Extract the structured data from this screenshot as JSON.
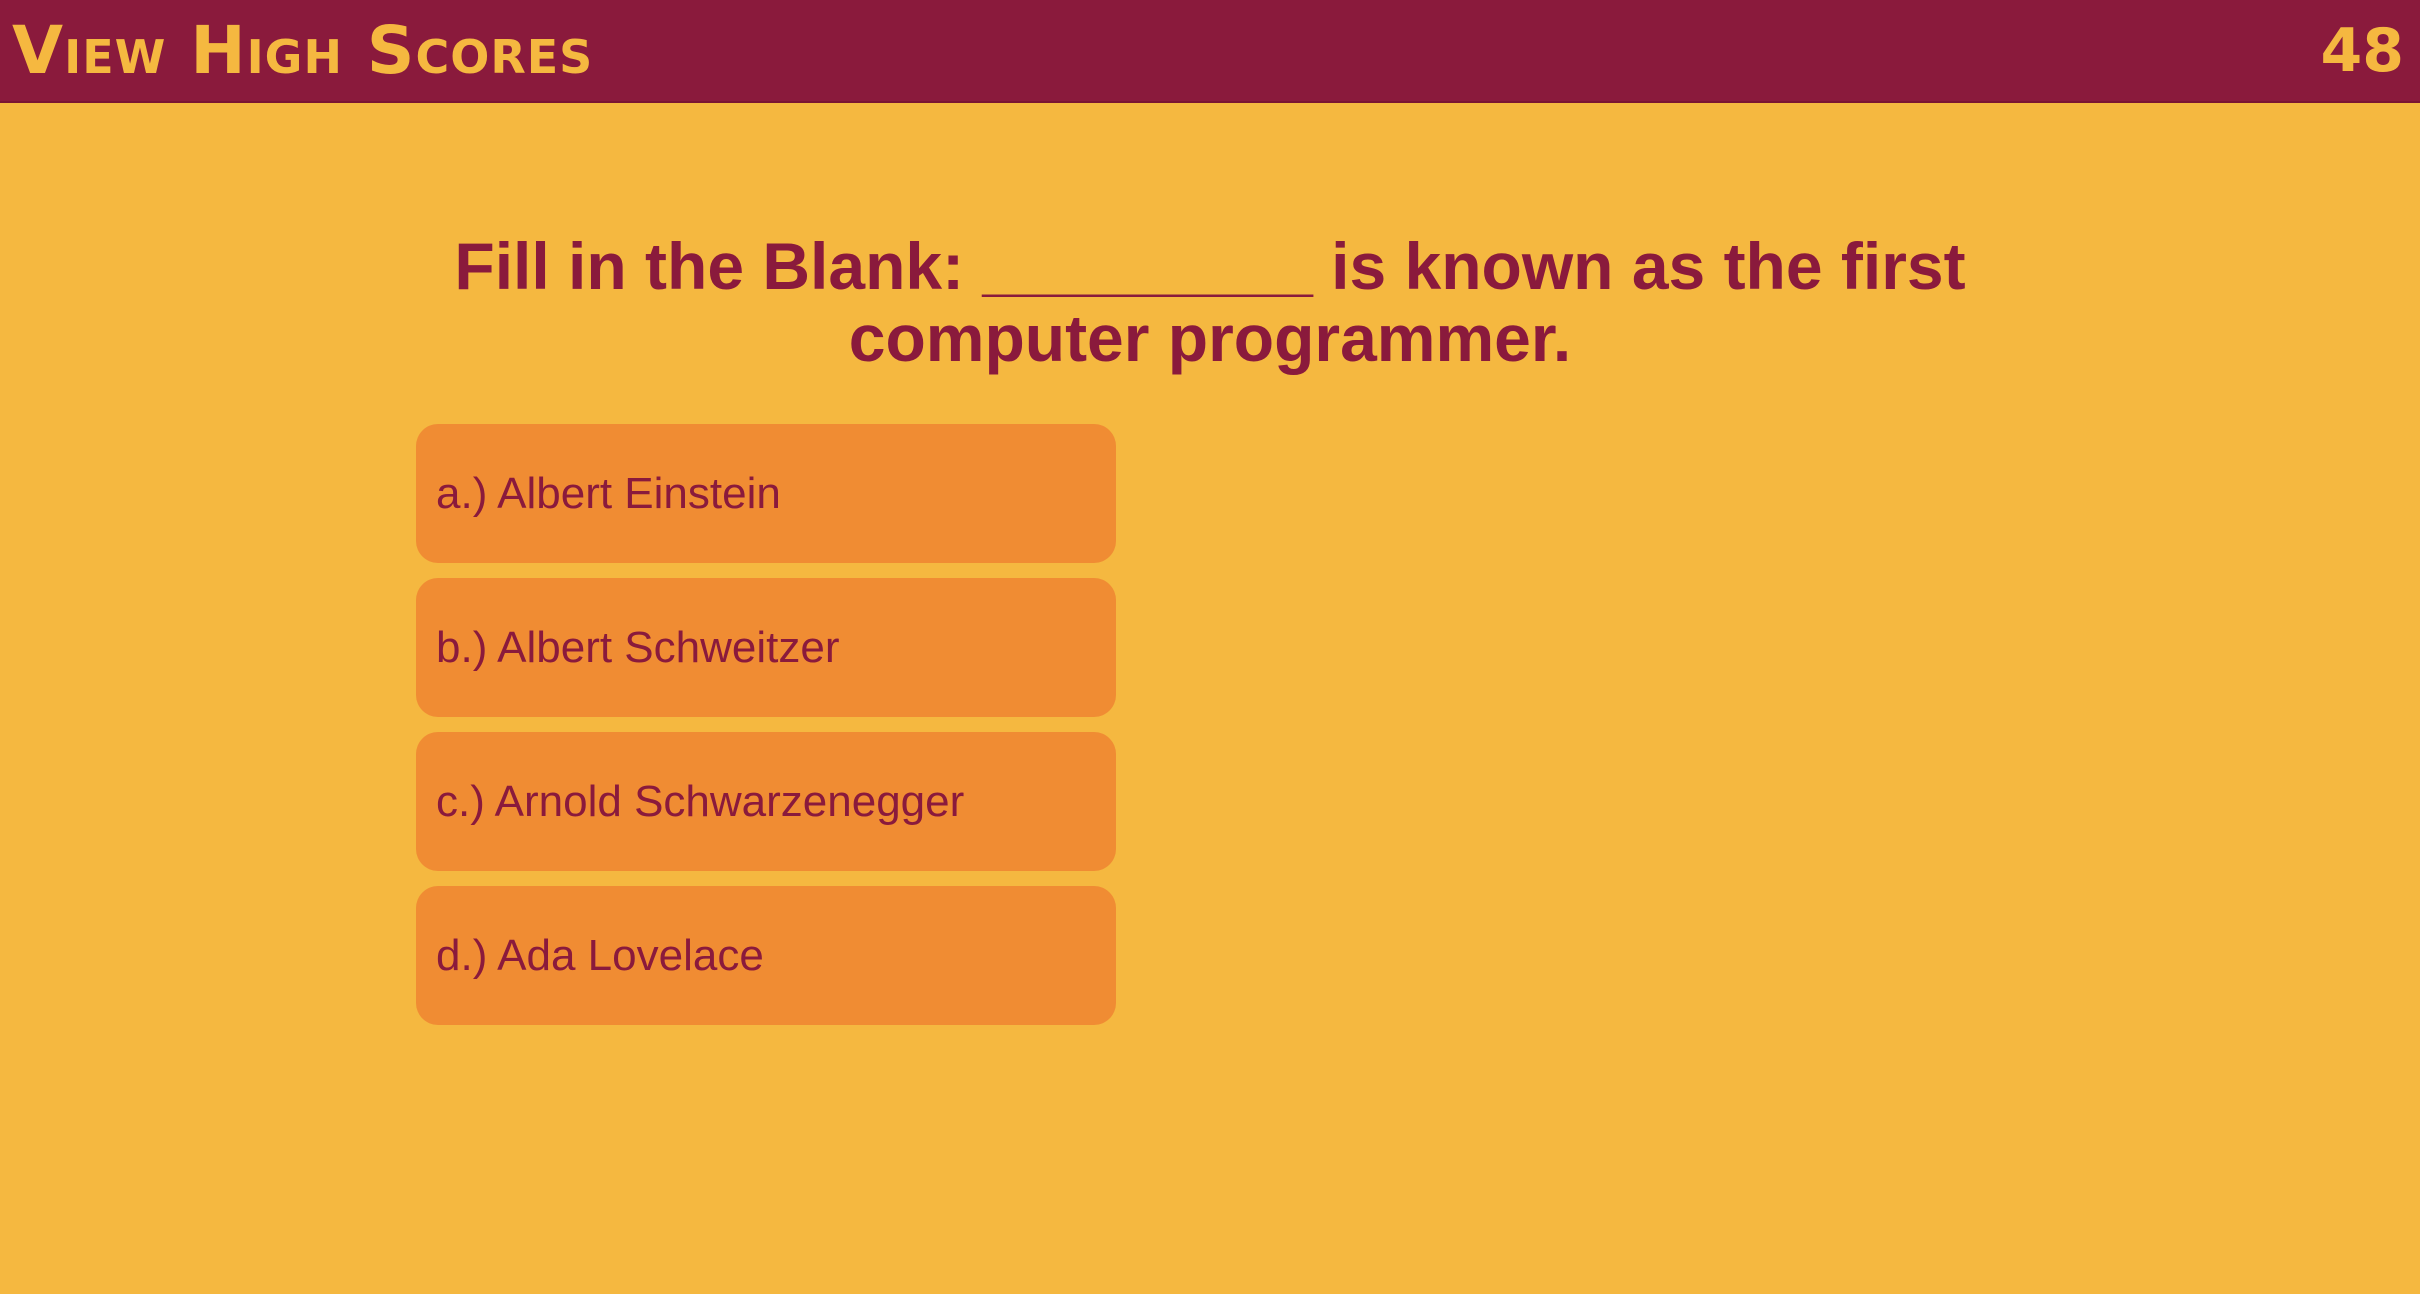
{
  "header": {
    "high_scores_link": "View High Scores",
    "timer": "48"
  },
  "quiz": {
    "question": "Fill in the Blank: _________ is known as the first computer programmer.",
    "answers": [
      "a.) Albert Einstein",
      "b.) Albert Schweitzer",
      "c.) Arnold Schwarzenegger",
      "d.) Ada Lovelace"
    ]
  },
  "colors": {
    "background": "#F5B840",
    "header_bg": "#8A1A3C",
    "answer_bg": "#F08C33",
    "text": "#8A1A3C"
  }
}
